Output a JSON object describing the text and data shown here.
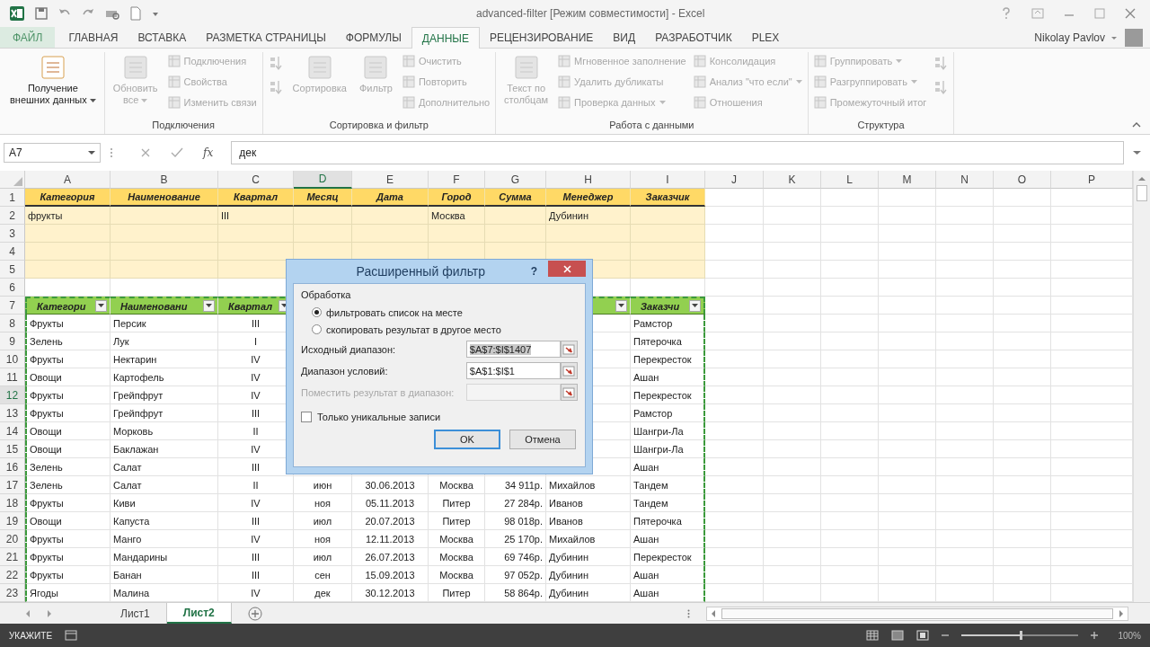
{
  "window": {
    "title": "advanced-filter [Режим совместимости] - Excel",
    "user": "Nikolay Pavlov"
  },
  "tabs": [
    {
      "label": "ФАЙЛ",
      "kind": "file",
      "selected": false
    },
    {
      "label": "ГЛАВНАЯ",
      "kind": "tab",
      "selected": false
    },
    {
      "label": "ВСТАВКА",
      "kind": "tab",
      "selected": false
    },
    {
      "label": "РАЗМЕТКА СТРАНИЦЫ",
      "kind": "tab",
      "selected": false
    },
    {
      "label": "ФОРМУЛЫ",
      "kind": "tab",
      "selected": false
    },
    {
      "label": "ДАННЫЕ",
      "kind": "tab",
      "selected": true
    },
    {
      "label": "РЕЦЕНЗИРОВАНИЕ",
      "kind": "tab",
      "selected": false
    },
    {
      "label": "ВИД",
      "kind": "tab",
      "selected": false
    },
    {
      "label": "РАЗРАБОТЧИК",
      "kind": "tab",
      "selected": false
    },
    {
      "label": "PLEX",
      "kind": "tab",
      "selected": false
    }
  ],
  "ribbon": {
    "groups": [
      {
        "columns": [
          [
            {
              "kind": "large",
              "label": "Получение\nвнешних данных",
              "dropdown": true,
              "disabled": false
            }
          ]
        ]
      },
      {
        "label": "Подключения",
        "columns": [
          [
            {
              "kind": "large",
              "label": "Обновить\nвсе",
              "dropdown": true,
              "disabled": true
            }
          ],
          [
            {
              "kind": "small",
              "label": "Подключения",
              "dropdown": false,
              "disabled": true
            },
            {
              "kind": "small",
              "label": "Свойства",
              "dropdown": false,
              "disabled": true
            },
            {
              "kind": "small",
              "label": "Изменить связи",
              "dropdown": false,
              "disabled": true
            }
          ]
        ]
      },
      {
        "label": "Сортировка и фильтр",
        "columns": [
          [
            {
              "kind": "icon",
              "dropdown": false,
              "disabled": true
            },
            {
              "kind": "icon",
              "dropdown": false,
              "disabled": true
            }
          ],
          [
            {
              "kind": "large",
              "label": "Сортировка",
              "dropdown": false,
              "disabled": true
            }
          ],
          [
            {
              "kind": "large",
              "label": "Фильтр",
              "dropdown": false,
              "disabled": true
            }
          ],
          [
            {
              "kind": "small",
              "label": "Очистить",
              "dropdown": false,
              "disabled": true
            },
            {
              "kind": "small",
              "label": "Повторить",
              "dropdown": false,
              "disabled": true
            },
            {
              "kind": "small",
              "label": "Дополнительно",
              "dropdown": false,
              "disabled": true
            }
          ]
        ]
      },
      {
        "label": "Работа с данными",
        "columns": [
          [
            {
              "kind": "large",
              "label": "Текст по\nстолбцам",
              "dropdown": false,
              "disabled": true
            }
          ],
          [
            {
              "kind": "small",
              "label": "Мгновенное заполнение",
              "dropdown": false,
              "disabled": true
            },
            {
              "kind": "small",
              "label": "Удалить дубликаты",
              "dropdown": false,
              "disabled": true
            },
            {
              "kind": "small",
              "label": "Проверка данных",
              "dropdown": true,
              "disabled": true
            }
          ],
          [
            {
              "kind": "small",
              "label": "Консолидация",
              "dropdown": false,
              "disabled": true
            },
            {
              "kind": "small",
              "label": "Анализ \"что если\"",
              "dropdown": true,
              "disabled": true
            },
            {
              "kind": "small",
              "label": "Отношения",
              "dropdown": false,
              "disabled": true
            }
          ]
        ]
      },
      {
        "label": "Структура",
        "columns": [
          [
            {
              "kind": "small",
              "label": "Группировать",
              "dropdown": true,
              "disabled": true
            },
            {
              "kind": "small",
              "label": "Разгруппировать",
              "dropdown": true,
              "disabled": true
            },
            {
              "kind": "small",
              "label": "Промежуточный итог",
              "dropdown": false,
              "disabled": true
            }
          ],
          [
            {
              "kind": "icon",
              "dropdown": false,
              "disabled": true
            },
            {
              "kind": "icon",
              "dropdown": false,
              "disabled": true
            }
          ]
        ]
      }
    ]
  },
  "formula_bar": {
    "name_box": "A7",
    "fx": "fx",
    "value": "дек"
  },
  "columns": [
    {
      "letter": "A",
      "selected": false
    },
    {
      "letter": "B",
      "selected": false
    },
    {
      "letter": "C",
      "selected": false
    },
    {
      "letter": "D",
      "selected": true
    },
    {
      "letter": "E",
      "selected": false
    },
    {
      "letter": "F",
      "selected": false
    },
    {
      "letter": "G",
      "selected": false
    },
    {
      "letter": "H",
      "selected": false
    },
    {
      "letter": "I",
      "selected": false
    },
    {
      "letter": "J",
      "selected": false
    },
    {
      "letter": "K",
      "selected": false
    },
    {
      "letter": "L",
      "selected": false
    },
    {
      "letter": "M",
      "selected": false
    },
    {
      "letter": "N",
      "selected": false
    },
    {
      "letter": "O",
      "selected": false
    },
    {
      "letter": "P",
      "selected": false
    }
  ],
  "rows": [
    {
      "num": "1",
      "kind": "criteria-header",
      "selected": false,
      "cells": {
        "A": "Категория",
        "B": "Наименование",
        "C": "Квартал",
        "D": "Месяц",
        "E": "Дата",
        "F": "Город",
        "G": "Сумма",
        "H": "Менеджер",
        "I": "Заказчик"
      }
    },
    {
      "num": "2",
      "kind": "criteria",
      "selected": false,
      "cells": {
        "A": "фрукты",
        "C": "III",
        "F": "Москва",
        "H": "Дубинин"
      }
    },
    {
      "num": "3",
      "kind": "criteria",
      "selected": false,
      "cells": {}
    },
    {
      "num": "4",
      "kind": "criteria",
      "selected": false,
      "cells": {}
    },
    {
      "num": "5",
      "kind": "criteria",
      "selected": false,
      "cells": {}
    },
    {
      "num": "6",
      "kind": "blank",
      "selected": false,
      "cells": {}
    },
    {
      "num": "7",
      "kind": "table-header",
      "selected": false,
      "cells": {
        "A": "Категори",
        "B": "Наименовани",
        "C": "Квартал",
        "I": "Заказчи"
      }
    },
    {
      "num": "8",
      "kind": "data",
      "selected": false,
      "cells": {
        "A": "Фрукты",
        "B": "Персик",
        "C": "III",
        "I": "Рамстор"
      }
    },
    {
      "num": "9",
      "kind": "data",
      "selected": false,
      "cells": {
        "A": "Зелень",
        "B": "Лук",
        "C": "I",
        "I": "Пятерочка"
      }
    },
    {
      "num": "10",
      "kind": "data",
      "selected": false,
      "cells": {
        "A": "Фрукты",
        "B": "Нектарин",
        "C": "IV",
        "I": "Перекресток"
      }
    },
    {
      "num": "11",
      "kind": "data",
      "selected": false,
      "cells": {
        "A": "Овощи",
        "B": "Картофель",
        "C": "IV",
        "I": "Ашан"
      }
    },
    {
      "num": "12",
      "kind": "data",
      "selected": true,
      "cells": {
        "A": "Фрукты",
        "B": "Грейпфрут",
        "C": "IV",
        "I": "Перекресток"
      }
    },
    {
      "num": "13",
      "kind": "data",
      "selected": false,
      "cells": {
        "A": "Фрукты",
        "B": "Грейпфрут",
        "C": "III",
        "I": "Рамстор"
      }
    },
    {
      "num": "14",
      "kind": "data",
      "selected": false,
      "cells": {
        "A": "Овощи",
        "B": "Морковь",
        "C": "II",
        "I": "Шангри-Ла"
      }
    },
    {
      "num": "15",
      "kind": "data",
      "selected": false,
      "cells": {
        "A": "Овощи",
        "B": "Баклажан",
        "C": "IV",
        "I": "Шангри-Ла"
      }
    },
    {
      "num": "16",
      "kind": "data",
      "selected": false,
      "cells": {
        "A": "Зелень",
        "B": "Салат",
        "C": "III",
        "I": "Ашан"
      }
    },
    {
      "num": "17",
      "kind": "data",
      "selected": false,
      "cells": {
        "A": "Зелень",
        "B": "Салат",
        "C": "II",
        "D": "июн",
        "E": "30.06.2013",
        "F": "Москва",
        "G": "34 911р.",
        "H": "Михайлов",
        "I": "Тандем"
      }
    },
    {
      "num": "18",
      "kind": "data",
      "selected": false,
      "cells": {
        "A": "Фрукты",
        "B": "Киви",
        "C": "IV",
        "D": "ноя",
        "E": "05.11.2013",
        "F": "Питер",
        "G": "27 284р.",
        "H": "Иванов",
        "I": "Тандем"
      }
    },
    {
      "num": "19",
      "kind": "data",
      "selected": false,
      "cells": {
        "A": "Овощи",
        "B": "Капуста",
        "C": "III",
        "D": "июл",
        "E": "20.07.2013",
        "F": "Питер",
        "G": "98 018р.",
        "H": "Иванов",
        "I": "Пятерочка"
      }
    },
    {
      "num": "20",
      "kind": "data",
      "selected": false,
      "cells": {
        "A": "Фрукты",
        "B": "Манго",
        "C": "IV",
        "D": "ноя",
        "E": "12.11.2013",
        "F": "Москва",
        "G": "25 170р.",
        "H": "Михайлов",
        "I": "Ашан"
      }
    },
    {
      "num": "21",
      "kind": "data",
      "selected": false,
      "cells": {
        "A": "Фрукты",
        "B": "Мандарины",
        "C": "III",
        "D": "июл",
        "E": "26.07.2013",
        "F": "Москва",
        "G": "69 746р.",
        "H": "Дубинин",
        "I": "Перекресток"
      }
    },
    {
      "num": "22",
      "kind": "data",
      "selected": false,
      "cells": {
        "A": "Фрукты",
        "B": "Банан",
        "C": "III",
        "D": "сен",
        "E": "15.09.2013",
        "F": "Москва",
        "G": "97 052р.",
        "H": "Дубинин",
        "I": "Ашан"
      }
    },
    {
      "num": "23",
      "kind": "data",
      "selected": false,
      "cells": {
        "A": "Ягоды",
        "B": "Малина",
        "C": "IV",
        "D": "дек",
        "E": "30.12.2013",
        "F": "Питер",
        "G": "58 864р.",
        "H": "Дубинин",
        "I": "Ашан"
      }
    }
  ],
  "dialog": {
    "title": "Расширенный фильтр",
    "help": "?",
    "section": "Обработка",
    "options": [
      {
        "label": "фильтровать список на месте",
        "selected": true
      },
      {
        "label": "скопировать результат в другое место",
        "selected": false
      }
    ],
    "fields": [
      {
        "label": "Исходный диапазон:",
        "value": "$A$7:$I$1407",
        "disabled": false,
        "highlighted": true
      },
      {
        "label": "Диапазон условий:",
        "value": "$A$1:$I$1",
        "disabled": false,
        "highlighted": false
      },
      {
        "label": "Поместить результат в диапазон:",
        "disabled": true,
        "highlighted": false
      }
    ],
    "checkbox": {
      "label": "Только уникальные записи",
      "checked": false
    },
    "buttons": [
      {
        "label": "OK",
        "default": true
      },
      {
        "label": "Отмена",
        "default": false
      }
    ]
  },
  "sheets": [
    {
      "label": "Лист1",
      "selected": false
    },
    {
      "label": "Лист2",
      "selected": true
    }
  ],
  "status_bar": {
    "mode": "УКАЖИТЕ",
    "zoom": {
      "level": 0.5
    },
    "zoom_label": "100%"
  }
}
